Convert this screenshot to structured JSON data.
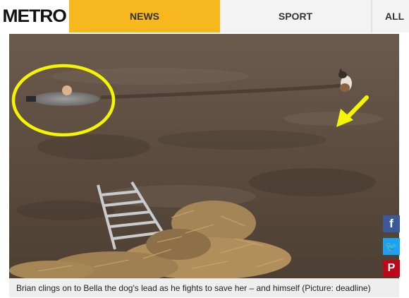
{
  "nav": {
    "logo": "METRO",
    "news_label": "NEWS",
    "sport_label": "SPORT",
    "all_label": "ALL"
  },
  "photo": {
    "caption": "Brian clings on to Bella the dog's lead as he fights to save her – and himself (Picture: deadline)"
  },
  "share": {
    "facebook_glyph": "f",
    "twitter_glyph": "🐦",
    "pinterest_glyph": "P"
  },
  "colors": {
    "news_accent": "#f7b71e",
    "annotation_yellow": "#f5f500",
    "facebook": "#3b5998",
    "twitter": "#1da1f2",
    "pinterest": "#bd081c"
  }
}
